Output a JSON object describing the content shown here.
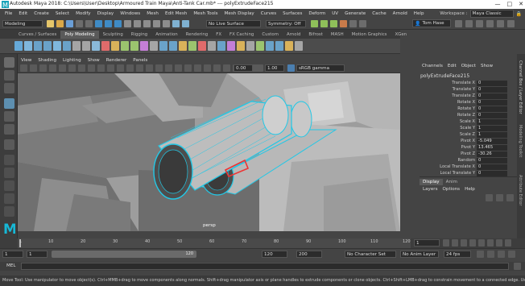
{
  "window": {
    "title": "Autodesk Maya 2018: C:\\Users\\User\\Desktop\\Armoured Train Maya\\Anti-Tank Car.mb*  ---  polyExtrudeFace215",
    "minimize": "—",
    "maximize": "□",
    "close": "✕"
  },
  "menubar": {
    "items": [
      "File",
      "Edit",
      "Create",
      "Select",
      "Modify",
      "Display",
      "Windows",
      "Mesh",
      "Edit Mesh",
      "Mesh Tools",
      "Mesh Display",
      "Curves",
      "Surfaces",
      "Deform",
      "UV",
      "Generate",
      "Cache",
      "Arnold",
      "Help"
    ],
    "workspace_label": "Workspace :",
    "workspace_value": "Maya Classic"
  },
  "statusline": {
    "mode": "Modeling",
    "live_surface": "No Live Surface",
    "symmetry": "Symmetry: Off",
    "user": "Tom Hase"
  },
  "shelf": {
    "tabs": [
      "Curves / Surfaces",
      "Poly Modeling",
      "Sculpting",
      "Rigging",
      "Animation",
      "Rendering",
      "FX",
      "FX Caching",
      "Custom",
      "Arnold",
      "Bifrost",
      "MASH",
      "Motion Graphics",
      "XGen"
    ],
    "active_tab": "Poly Modeling"
  },
  "viewport": {
    "menu": [
      "View",
      "Shading",
      "Lighting",
      "Show",
      "Renderer",
      "Panels"
    ],
    "value_a": "0.00",
    "value_b": "1.00",
    "color_space": "sRGB gamma",
    "camera_label": "persp"
  },
  "channelbox": {
    "menu": [
      "Channels",
      "Edit",
      "Object",
      "Show"
    ],
    "object_name": "polyExtrudeFace215",
    "attributes": [
      {
        "name": "Translate X",
        "value": "0"
      },
      {
        "name": "Translate Y",
        "value": "0"
      },
      {
        "name": "Translate Z",
        "value": "0"
      },
      {
        "name": "Rotate X",
        "value": "0"
      },
      {
        "name": "Rotate Y",
        "value": "0"
      },
      {
        "name": "Rotate Z",
        "value": "0"
      },
      {
        "name": "Scale X",
        "value": "1"
      },
      {
        "name": "Scale Y",
        "value": "1"
      },
      {
        "name": "Scale Z",
        "value": "1"
      },
      {
        "name": "Pivot X",
        "value": "-5.049"
      },
      {
        "name": "Pivot Y",
        "value": "13.465"
      },
      {
        "name": "Pivot Z",
        "value": "-30.26"
      },
      {
        "name": "Random",
        "value": "0"
      },
      {
        "name": "Local Translate X",
        "value": "0"
      },
      {
        "name": "Local Translate Y",
        "value": "0"
      }
    ]
  },
  "layers": {
    "tabs": [
      "Display",
      "Anim"
    ],
    "menu": [
      "Layers",
      "Options",
      "Help"
    ]
  },
  "side_tabs": [
    "Channel Box / Layer Editor",
    "Modeling Toolkit",
    "Attribute Editor"
  ],
  "timeline": {
    "ticks": [
      "1",
      "10",
      "20",
      "30",
      "40",
      "50",
      "60",
      "70",
      "80",
      "90",
      "100",
      "110",
      "120"
    ],
    "current_frame": "1",
    "current_frame_right": "120"
  },
  "range": {
    "start": "1",
    "start_inner": "1",
    "range_end_label": "120",
    "end_inner": "120",
    "end": "200",
    "character_set": "No Character Set",
    "anim_layer": "No Anim Layer",
    "fps": "24 fps"
  },
  "mel": {
    "label": "MEL"
  },
  "helpline": {
    "text": "Move Tool: Use manipulator to move object(s). Ctrl+MMB+drag to move components along normals. Shift+drag manipulator axis or plane handles to extrude components or clone objects. Ctrl+Shift+LMB+drag to constrain movement to a connected edge. Use D or INSERT to change the pivot position a"
  },
  "colors": {
    "accent_selection": "#22c8e6",
    "highlight_red": "#e33"
  }
}
